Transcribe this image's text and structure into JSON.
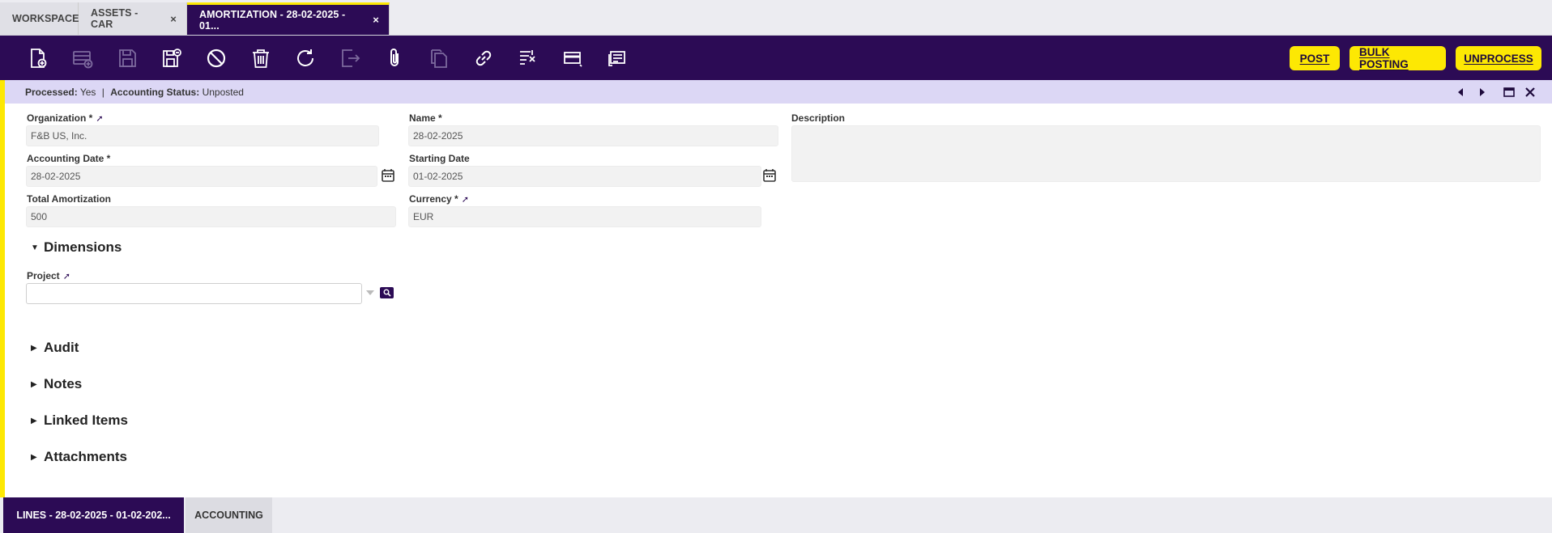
{
  "tabs": [
    {
      "label": "WORKSPACE"
    },
    {
      "label": "ASSETS - CAR",
      "close": "×"
    },
    {
      "label": "AMORTIZATION - 28-02-2025 - 01...",
      "close": "×"
    }
  ],
  "toolbar": {
    "icons": [
      "new-document-icon",
      "new-row-icon",
      "save-icon",
      "save-close-icon",
      "cancel-icon",
      "delete-icon",
      "refresh-icon",
      "export-icon",
      "attachment-icon",
      "copy-record-icon",
      "link-icon",
      "filter-list-icon",
      "toggle-grid-icon",
      "audit-trail-icon"
    ],
    "buttons": {
      "post": "POST",
      "bulk_posting": "BULK POSTING",
      "unprocess": "UNPROCESS"
    }
  },
  "status": {
    "processed_label": "Processed:",
    "processed_value": "Yes",
    "separator": "|",
    "accounting_label": "Accounting Status:",
    "accounting_value": "Unposted"
  },
  "form": {
    "organization": {
      "label": "Organization *",
      "value": "F&B US, Inc."
    },
    "name": {
      "label": "Name *",
      "value": "28-02-2025"
    },
    "description": {
      "label": "Description",
      "value": ""
    },
    "accounting_date": {
      "label": "Accounting Date *",
      "value": "28-02-2025"
    },
    "starting_date": {
      "label": "Starting Date",
      "value": "01-02-2025"
    },
    "total_amortization": {
      "label": "Total Amortization",
      "value": "500"
    },
    "currency": {
      "label": "Currency *",
      "value": "EUR"
    },
    "project": {
      "label": "Project",
      "value": ""
    }
  },
  "sections": {
    "dimensions": "Dimensions",
    "audit": "Audit",
    "notes": "Notes",
    "linked_items": "Linked Items",
    "attachments": "Attachments"
  },
  "bottom_tabs": [
    {
      "label": "LINES - 28-02-2025 - 01-02-202..."
    },
    {
      "label": "ACCOUNTING"
    }
  ],
  "colors": {
    "brand": "#2c0b55",
    "accent": "#fde803",
    "status_bg": "#dcd7f5"
  }
}
